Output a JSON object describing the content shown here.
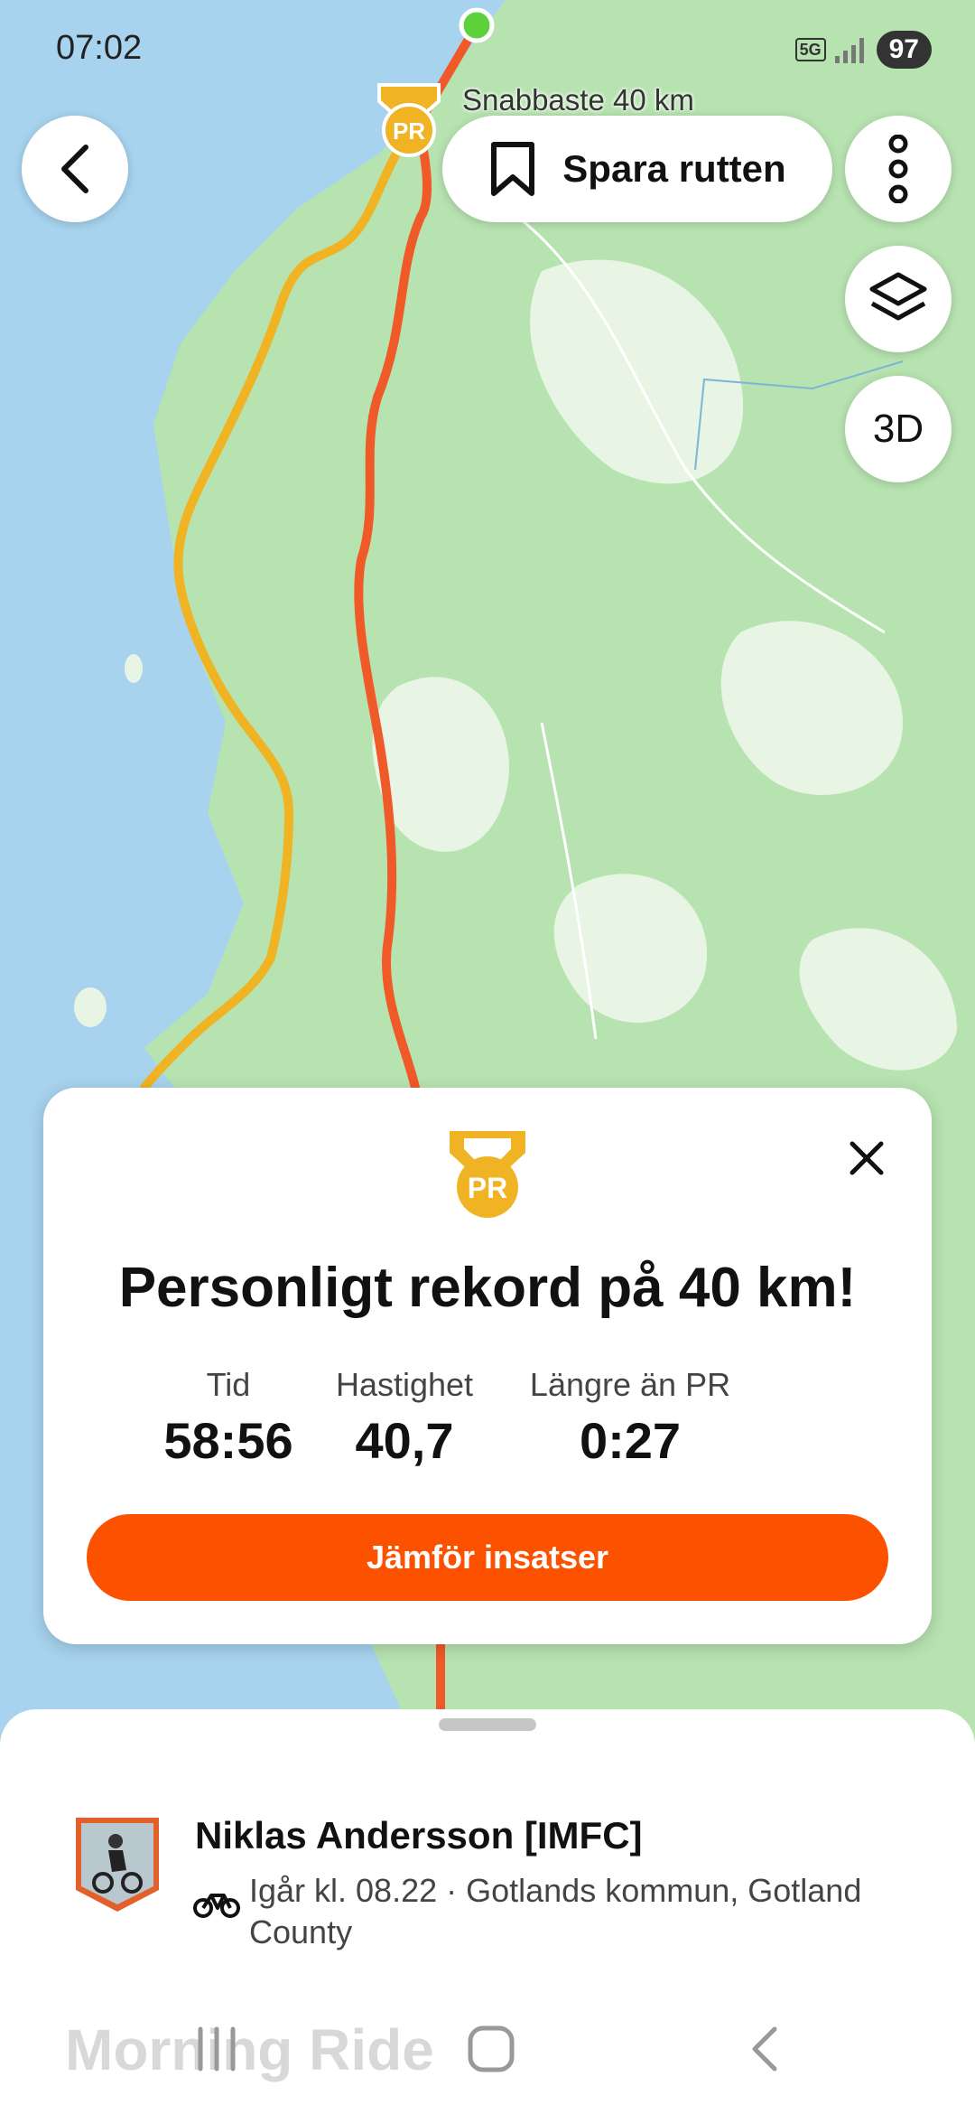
{
  "status_bar": {
    "time": "07:02",
    "network": "5G",
    "battery": "97"
  },
  "map": {
    "segment_label": "Snabbaste 40 km",
    "pr_badge": "PR",
    "colors": {
      "water": "#a7d3ee",
      "land": "#b7e3b0",
      "pr_route": "#f0b323",
      "route": "#f05a28",
      "start": "#5cd13b"
    }
  },
  "toolbar": {
    "back_icon": "chevron-left-icon",
    "save_label": "Spara rutten",
    "more_icon": "more-vertical-icon",
    "layers_icon": "layers-icon",
    "view_3d": "3D"
  },
  "pr_card": {
    "badge": "PR",
    "title": "Personligt rekord på 40 km!",
    "stats": [
      {
        "label": "Tid",
        "value": "58:56"
      },
      {
        "label": "Hastighet",
        "value": "40,7"
      },
      {
        "label": "Längre än PR",
        "value": "0:27"
      }
    ],
    "cta": "Jämför insatser",
    "accent": "#fc5200"
  },
  "activity": {
    "athlete": "Niklas Andersson [IMFC]",
    "meta": "Igår kl. 08.22 · Gotlands kommun, Gotland County",
    "title": "Morning Ride"
  }
}
